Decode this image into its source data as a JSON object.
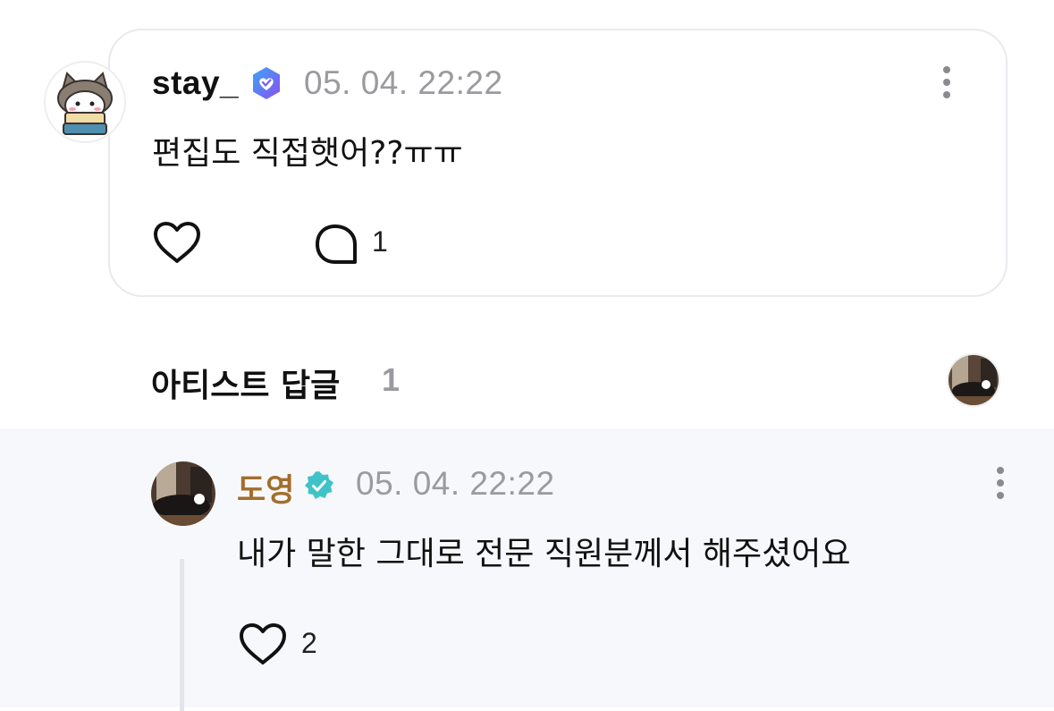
{
  "comment": {
    "username": "stay_",
    "timestamp": "05. 04. 22:22",
    "text": "편집도 직접햇어??ㅠㅠ",
    "reply_count": "1",
    "icons": {
      "like": "heart-outline-icon",
      "reply": "speech-bubble-icon",
      "more": "more-vertical-icon",
      "verified": "fan-verified-badge-icon"
    }
  },
  "artist_replies": {
    "title": "아티스트 답글",
    "count": "1"
  },
  "reply": {
    "username": "도영",
    "timestamp": "05. 04. 22:22",
    "text": "내가 말한 그대로 전문 직원분께서 해주셨어요",
    "like_count": "2",
    "name_color": "#a36e2b",
    "icons": {
      "like": "heart-outline-icon",
      "more": "more-vertical-icon",
      "verified": "artist-verified-badge-icon"
    }
  },
  "colors": {
    "fan_badge": "#6f5cf5",
    "artist_badge": "#3fc3c9",
    "timestamp": "#9a9a9f",
    "reply_background": "#f7f8fb"
  }
}
